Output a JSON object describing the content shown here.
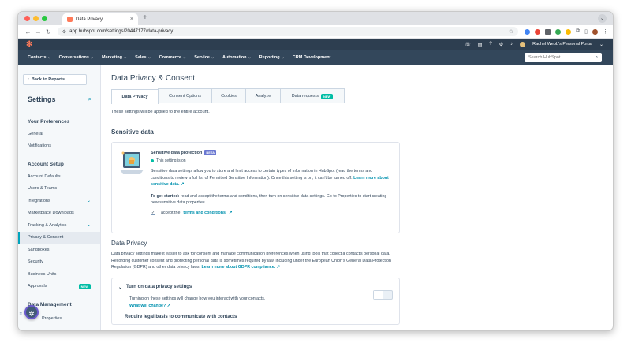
{
  "browser": {
    "tab_title": "Data Privacy",
    "url": "app.hubspot.com/settings/20447177/data-privacy",
    "colors": {
      "red": "#ff5f57",
      "yellow": "#febc2e",
      "green": "#28c840"
    }
  },
  "topbar": {
    "portal": "Rachel Webb's Personal Portal"
  },
  "nav": {
    "items": [
      "Contacts",
      "Conversations",
      "Marketing",
      "Sales",
      "Commerce",
      "Service",
      "Automation",
      "Reporting",
      "CRM Development"
    ],
    "search_placeholder": "Search HubSpot"
  },
  "sidebar": {
    "back_label": "Back to Reports",
    "title": "Settings",
    "sections": [
      {
        "heading": "Your Preferences",
        "items": [
          "General",
          "Notifications"
        ]
      },
      {
        "heading": "Account Setup",
        "items": [
          "Account Defaults",
          "Users & Teams",
          "Integrations",
          "Marketplace Downloads",
          "Tracking & Analytics",
          "Privacy & Consent",
          "Sandboxes",
          "Security",
          "Business Units",
          "Approvals"
        ]
      },
      {
        "heading": "Data Management"
      }
    ],
    "new_badge": "NEW",
    "partial_item": "Properties"
  },
  "content": {
    "page_title": "Data Privacy & Consent",
    "tabs": [
      "Data Privacy",
      "Consent Options",
      "Cookies",
      "Analyze",
      "Data requests"
    ],
    "tab_badge": "NEW",
    "applied_note": "These settings will be applied to the entire account.",
    "sensitive": {
      "heading": "Sensitive data",
      "title": "Sensitive data protection",
      "badge": "BETA",
      "status": "This setting is on",
      "para1": "Sensitive data settings allow you to store and limit access to certain types of information in HubSpot (read the terms and conditions to review a full list of Permitted Sensitive Information). Once this setting is on, it can't be turned off.",
      "link1": "Learn more about sensitive data.",
      "started_bold": "To get started:",
      "started_text": "read and accept the terms and conditions, then turn on sensitive data settings. Go to Properties to start creating new sensitive data properties.",
      "accept_text": "I accept the",
      "accept_link": "terms and conditions"
    },
    "privacy": {
      "heading": "Data Privacy",
      "para": "Data privacy settings make it easier to ask for consent and manage communication preferences when using tools that collect a contact's personal data. Recording customer consent and protecting personal data is sometimes required by law, including under the European Union's General Data Protection Regulation (GDPR) and other data privacy laws.",
      "link": "Learn more about GDPR compliance.",
      "toggle_title": "Turn on data privacy settings",
      "toggle_text": "Turning on these settings will change how you interact with your contacts.",
      "toggle_link": "What will change?",
      "sub_heading": "Require legal basis to communicate with contacts"
    }
  }
}
